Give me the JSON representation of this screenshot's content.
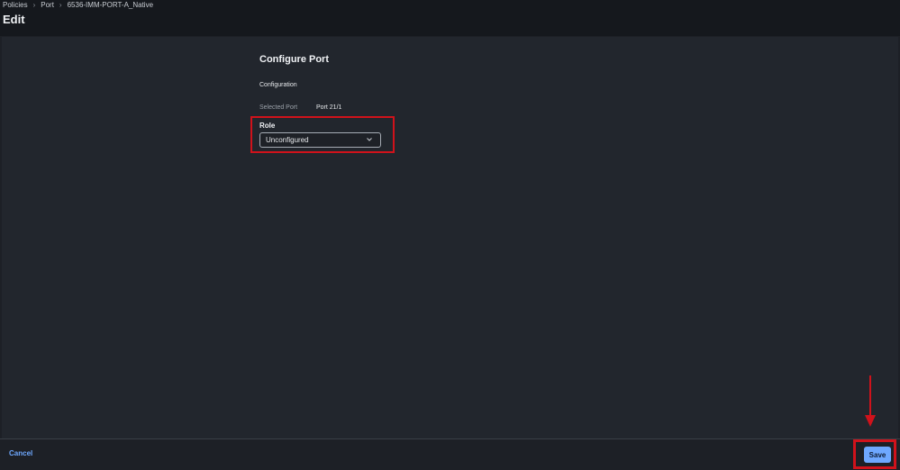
{
  "breadcrumb": {
    "items": [
      "Policies",
      "Port",
      "6536-IMM-PORT-A_Native"
    ]
  },
  "page": {
    "title": "Edit"
  },
  "form": {
    "section_title": "Configure Port",
    "subsection": "Configuration",
    "selected_port_label": "Selected Port",
    "selected_port_value": "Port 21/1",
    "role_label": "Role",
    "role_value": "Unconfigured"
  },
  "footer": {
    "cancel_label": "Cancel",
    "save_label": "Save"
  },
  "colors": {
    "accent": "#6ea8ff",
    "highlight": "#d0121b",
    "background": "#22262d"
  }
}
